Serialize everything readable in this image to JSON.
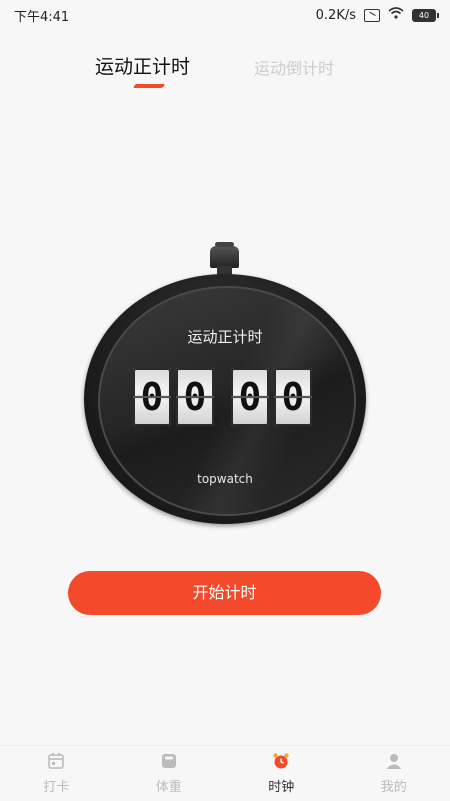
{
  "status_bar": {
    "time": "下午4:41",
    "network_speed": "0.2K/s",
    "battery_level": "40"
  },
  "tabs": [
    {
      "label": "运动正计时",
      "active": true
    },
    {
      "label": "运动倒计时",
      "active": false
    }
  ],
  "stopwatch": {
    "title": "运动正计时",
    "digits": [
      "0",
      "0",
      "0",
      "0"
    ],
    "brand": "topwatch"
  },
  "start_button": {
    "label": "开始计时"
  },
  "bottom_nav": [
    {
      "label": "打卡",
      "icon": "calendar-icon",
      "active": false
    },
    {
      "label": "体重",
      "icon": "scale-icon",
      "active": false
    },
    {
      "label": "时钟",
      "icon": "alarm-clock-icon",
      "active": true
    },
    {
      "label": "我的",
      "icon": "user-icon",
      "active": false
    }
  ],
  "colors": {
    "accent": "#f24a2a",
    "background": "#f7f7f7",
    "inactive_text": "#bbbbbb"
  }
}
